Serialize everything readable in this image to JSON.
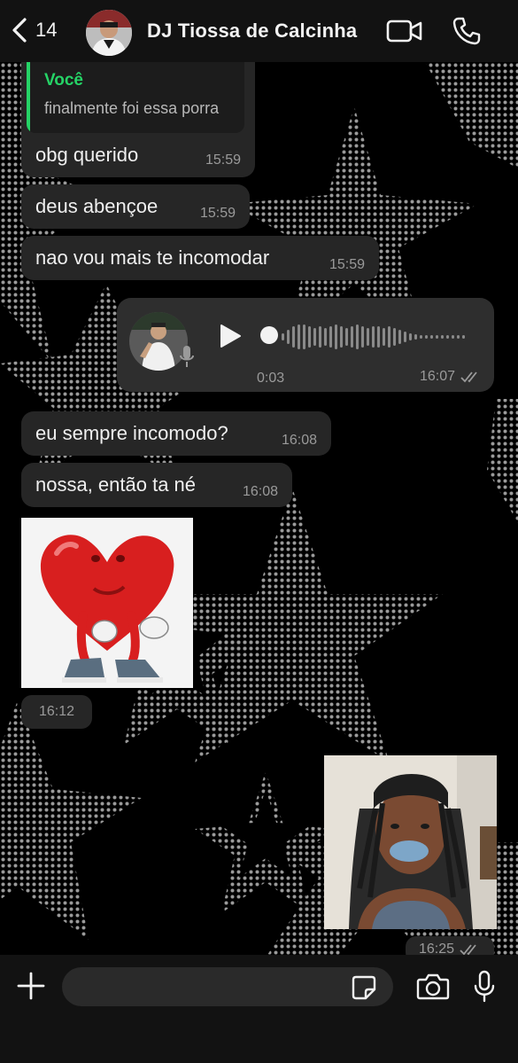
{
  "header": {
    "back_count": "14",
    "contact_name": "DJ Tiossa de Calcinha",
    "icons": [
      "back-chevron-icon",
      "video-call-icon",
      "phone-icon"
    ]
  },
  "messages": [
    {
      "quoted_author": "Você",
      "quoted_text": "finalmente foi essa porra",
      "text": "obg querido",
      "time": "15:59"
    },
    {
      "text": "deus abençoe",
      "time": "15:59"
    },
    {
      "text": "nao vou mais te incomodar",
      "time": "15:59"
    },
    {
      "type": "audio",
      "duration": "0:03",
      "time": "16:07",
      "status": "read"
    },
    {
      "text": "eu sempre incomodo?",
      "time": "16:08"
    },
    {
      "text": "nossa, então ta né",
      "time": "16:08"
    },
    {
      "type": "sticker",
      "time": "16:12"
    },
    {
      "type": "video",
      "time": "16:25",
      "status": "read"
    }
  ],
  "composer": {
    "placeholder": "",
    "icons": [
      "plus-icon",
      "sticker-icon",
      "camera-icon",
      "microphone-icon"
    ]
  },
  "colors": {
    "accent": "#25d366",
    "bubble": "#262626",
    "background": "#0b0b0b"
  }
}
